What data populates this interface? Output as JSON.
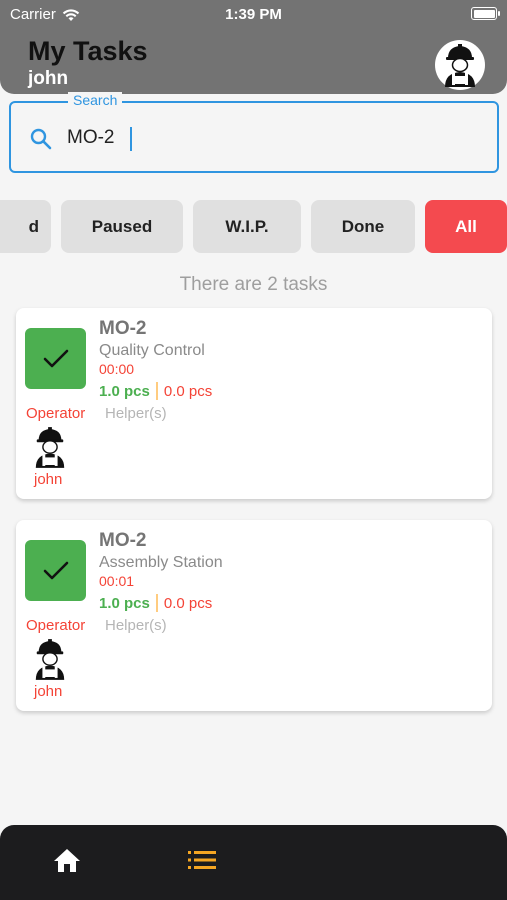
{
  "status_bar": {
    "carrier": "Carrier",
    "time": "1:39 PM"
  },
  "header": {
    "title": "My Tasks",
    "user": "john"
  },
  "search": {
    "label": "Search",
    "value": "MO-2"
  },
  "filters": [
    {
      "label": "d",
      "active": false
    },
    {
      "label": "Paused",
      "active": false
    },
    {
      "label": "W.I.P.",
      "active": false
    },
    {
      "label": "Done",
      "active": false
    },
    {
      "label": "All",
      "active": true
    }
  ],
  "task_count_text": "There are 2 tasks",
  "tasks": [
    {
      "id": "MO-2",
      "station": "Quality Control",
      "time": "00:00",
      "good_qty": "1.0 pcs",
      "bad_qty": "0.0 pcs",
      "operator_label": "Operator",
      "helper_label": "Helper(s)",
      "operator_name": "john"
    },
    {
      "id": "MO-2",
      "station": "Assembly Station",
      "time": "00:01",
      "good_qty": "1.0 pcs",
      "bad_qty": "0.0 pcs",
      "operator_label": "Operator",
      "helper_label": "Helper(s)",
      "operator_name": "john"
    }
  ],
  "bottom_nav": {
    "items": [
      {
        "icon": "home-icon",
        "active": false
      },
      {
        "icon": "list-icon",
        "active": true
      }
    ],
    "active_color": "#f5a623"
  },
  "colors": {
    "header_bg": "#737373",
    "accent_blue": "#2f95e0",
    "chip_active": "#f44a4f",
    "done_green": "#4caf50",
    "error_red": "#f44336"
  }
}
